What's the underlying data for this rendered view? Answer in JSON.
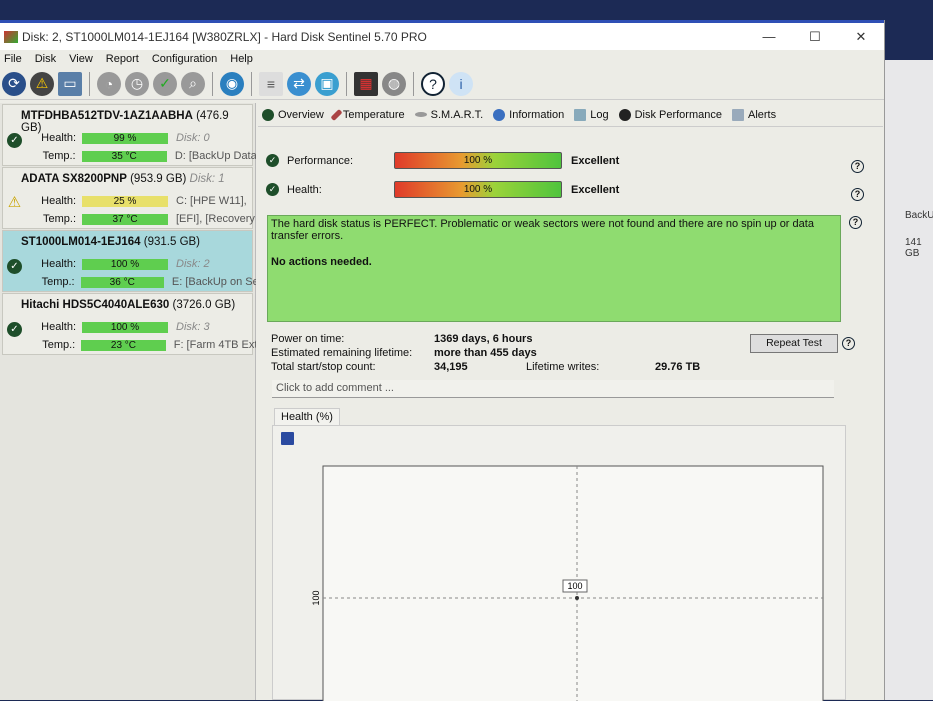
{
  "window": {
    "title": "Disk: 2, ST1000LM014-1EJ164 [W380ZRLX]  -  Hard Disk Sentinel 5.70 PRO",
    "controls": [
      "—",
      "☐",
      "✕"
    ]
  },
  "menu": [
    "File",
    "Disk",
    "View",
    "Report",
    "Configuration",
    "Help"
  ],
  "desktop": {
    "label": "BackU",
    "size": "141 GB"
  },
  "disks": [
    {
      "name": "MTFDHBA512TDV-1AZ1AABHA",
      "size": "(476.9 GB)",
      "health": "99 %",
      "temp": "35 °C",
      "disk": "Disk: 0",
      "volumes": "D: [BackUp Data",
      "status": "ok"
    },
    {
      "name": "ADATA SX8200PNP",
      "size": "(953.9 GB)",
      "diskinline": "Disk: 1",
      "health": "25 %",
      "temp": "37 °C",
      "disk": "C: [HPE W11],",
      "volumes": "[EFI],  [Recovery",
      "status": "warn"
    },
    {
      "name": "ST1000LM014-1EJ164",
      "size": "(931.5 GB)",
      "health": "100 %",
      "temp": "36 °C",
      "disk": "Disk: 2",
      "volumes": "E: [BackUp on Se",
      "status": "ok"
    },
    {
      "name": "Hitachi HDS5C4040ALE630",
      "size": "(3726.0 GB)",
      "health": "100 %",
      "temp": "23 °C",
      "disk": "Disk: 3",
      "volumes": "F: [Farm 4TB Ext",
      "status": "ok"
    }
  ],
  "labels": {
    "health": "Health:",
    "temp": "Temp.:"
  },
  "tabs": [
    "Overview",
    "Temperature",
    "S.M.A.R.T.",
    "Information",
    "Log",
    "Disk Performance",
    "Alerts"
  ],
  "overview": {
    "performance": {
      "label": "Performance:",
      "value": "100 %",
      "rating": "Excellent",
      "percent": 100
    },
    "health": {
      "label": "Health:",
      "value": "100 %",
      "rating": "Excellent",
      "percent": 100
    },
    "status_text": "The hard disk status is PERFECT. Problematic or weak sectors were not found and there are no spin up or data transfer errors.",
    "action_text": "No actions needed.",
    "power_on_label": "Power on time:",
    "power_on": "1369 days, 6 hours",
    "lifetime_label": "Estimated remaining lifetime:",
    "lifetime": "more than 455 days",
    "startstop_label": "Total start/stop count:",
    "startstop": "34,195",
    "writes_label": "Lifetime writes:",
    "writes": "29.76 TB",
    "repeat_test": "Repeat Test",
    "comment_placeholder": "Click to add comment ...",
    "chart_tab": "Health (%)"
  },
  "chart_data": {
    "type": "line",
    "title": "Health (%)",
    "series": [
      {
        "name": "Health",
        "values": [
          100
        ]
      }
    ],
    "ylabel_tick": "100",
    "point_label": "100"
  }
}
